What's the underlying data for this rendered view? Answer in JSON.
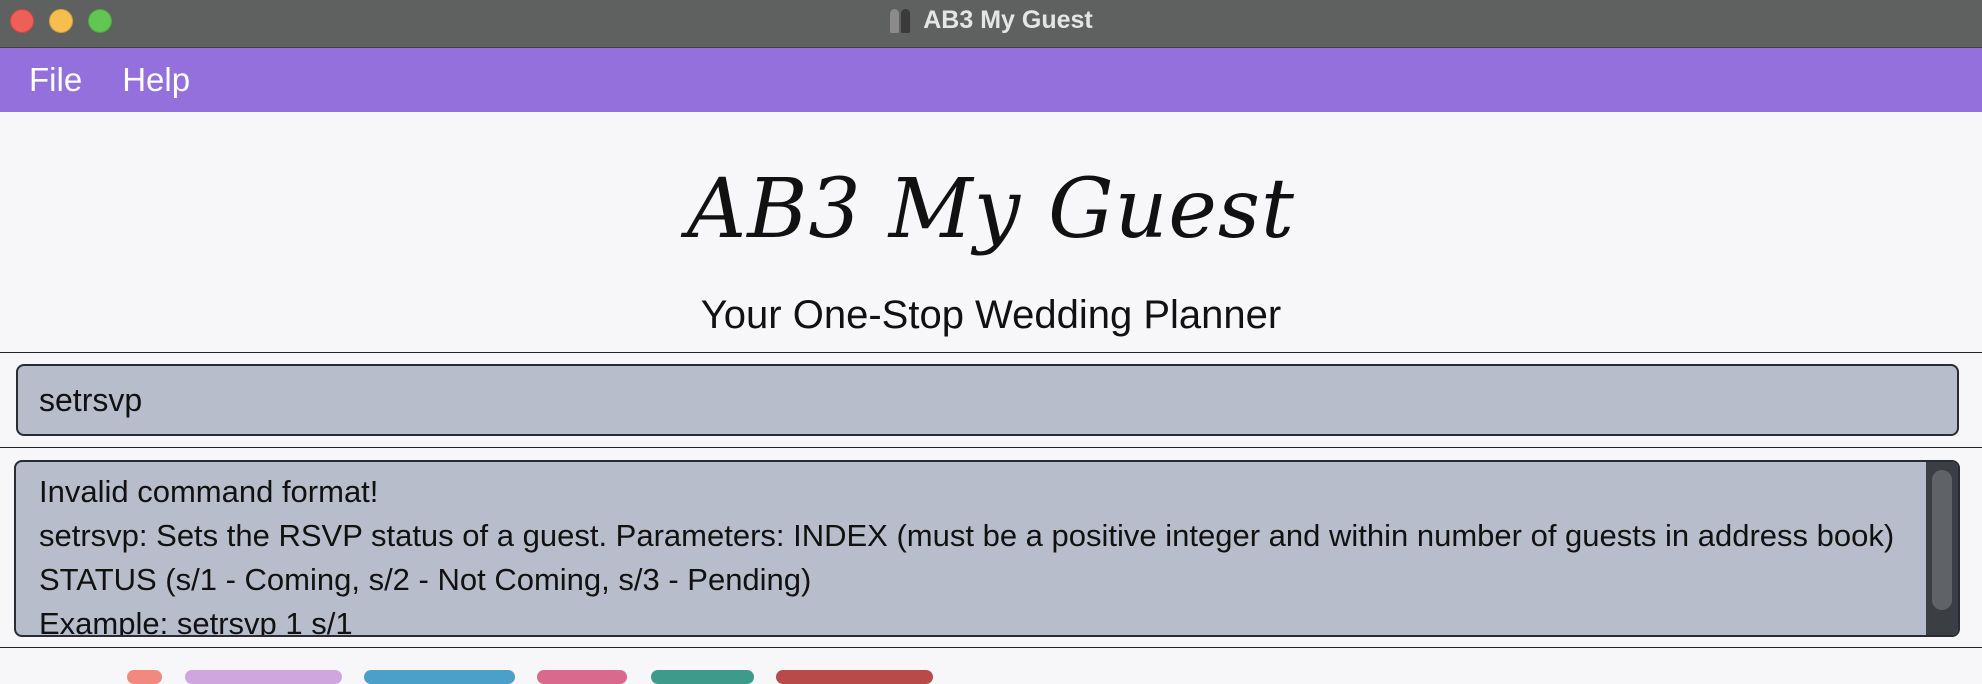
{
  "window": {
    "title": "AB3 My Guest",
    "icon": "bride-groom-icon"
  },
  "menu": {
    "items": [
      {
        "label": "File"
      },
      {
        "label": "Help"
      }
    ]
  },
  "header": {
    "app_name": "AB3 My Guest",
    "tagline": "Your One-Stop Wedding Planner"
  },
  "command": {
    "value": "setrsvp"
  },
  "result": {
    "lines": [
      "Invalid command format!",
      "setrsvp: Sets the RSVP status of a guest. Parameters: INDEX (must be a positive integer and within number of guests in address book) STATUS (s/1 - Coming, s/2 - Not Coming, s/3 - Pending)",
      "Example: setrsvp 1 s/1"
    ]
  },
  "colors": {
    "menu_bar": "#9370db",
    "title_bar": "#5f6161",
    "input_background": "#b7bdcb",
    "page_background": "#f7f7fa"
  },
  "tags": [
    {
      "color": "#f08a7e"
    },
    {
      "color": "#cfa6dd"
    },
    {
      "color": "#4aa0c9"
    },
    {
      "color": "#d96a8e"
    },
    {
      "color": "#3e9a8a"
    },
    {
      "color": "#b94a4a"
    }
  ]
}
